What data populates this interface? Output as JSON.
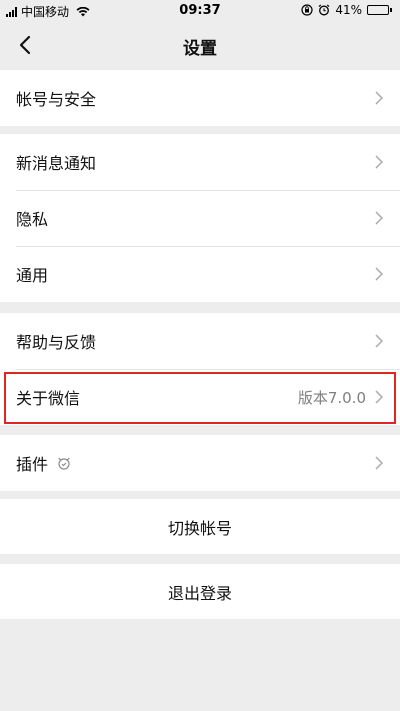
{
  "status_bar": {
    "carrier": "中国移动",
    "time": "09:37",
    "battery": "41%",
    "battery_level": 0.41
  },
  "nav": {
    "title": "设置"
  },
  "groups": [
    {
      "items": [
        {
          "label": "帐号与安全"
        }
      ]
    },
    {
      "items": [
        {
          "label": "新消息通知"
        },
        {
          "label": "隐私"
        },
        {
          "label": "通用"
        }
      ]
    },
    {
      "items": [
        {
          "label": "帮助与反馈"
        },
        {
          "label": "关于微信",
          "value": "版本7.0.0"
        }
      ]
    },
    {
      "items": [
        {
          "label": "插件"
        }
      ]
    }
  ],
  "actions": {
    "switch_account": "切换帐号",
    "logout": "退出登录"
  },
  "colors": {
    "highlight": "#e0271e",
    "background": "#ededed"
  }
}
